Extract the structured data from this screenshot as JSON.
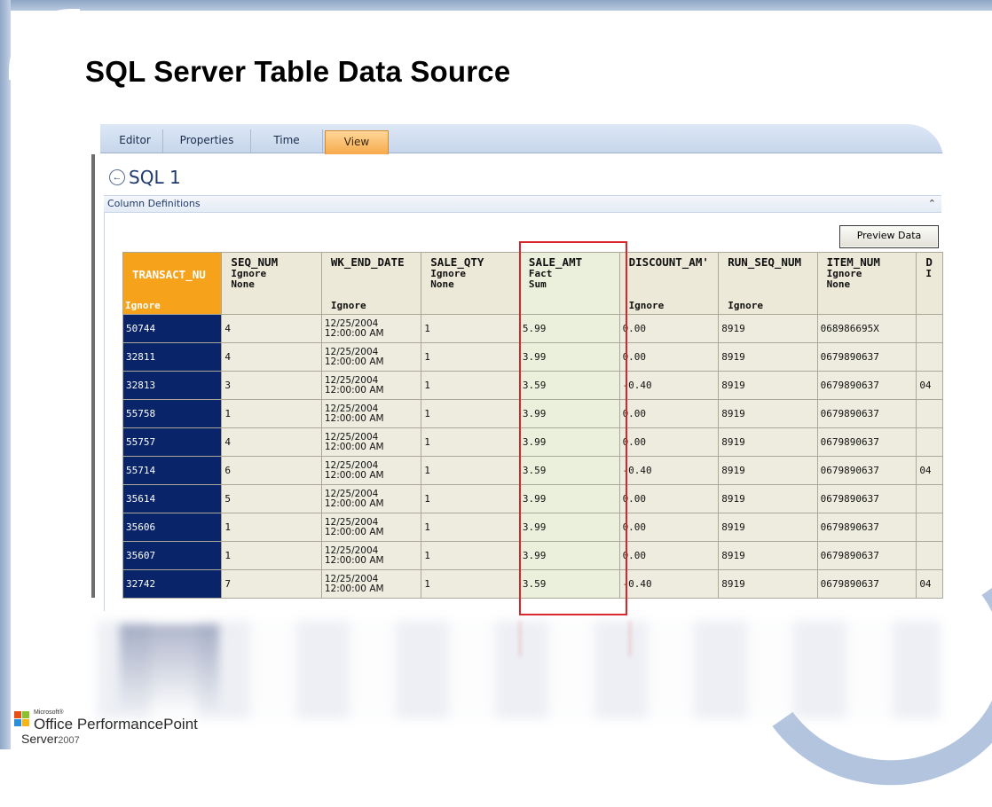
{
  "slide": {
    "title": "SQL Server Table Data Source"
  },
  "app": {
    "tabs": [
      {
        "label": "Editor",
        "active": false
      },
      {
        "label": "Properties",
        "active": false
      },
      {
        "label": "Time",
        "active": false
      },
      {
        "label": "View",
        "active": true
      }
    ],
    "pane_title": "SQL 1",
    "back_icon": "back-arrow-icon",
    "section_title": "Column Definitions",
    "collapse_icon": "double-chevron-up-icon",
    "preview_button": "Preview Data"
  },
  "grid": {
    "columns": [
      {
        "name": "TRANSACT_NU",
        "meta1": "",
        "meta2": "",
        "bottom": "Ignore"
      },
      {
        "name": "SEQ_NUM",
        "meta1": "Ignore",
        "meta2": "None",
        "bottom": ""
      },
      {
        "name": "WK_END_DATE",
        "meta1": "",
        "meta2": "",
        "bottom": "Ignore"
      },
      {
        "name": "SALE_QTY",
        "meta1": "Ignore",
        "meta2": "None",
        "bottom": ""
      },
      {
        "name": "SALE_AMT",
        "meta1": "Fact",
        "meta2": "Sum",
        "bottom": ""
      },
      {
        "name": "DISCOUNT_AM'",
        "meta1": "",
        "meta2": "",
        "bottom": "Ignore"
      },
      {
        "name": "RUN_SEQ_NUM",
        "meta1": "",
        "meta2": "",
        "bottom": "Ignore"
      },
      {
        "name": "ITEM_NUM",
        "meta1": "Ignore",
        "meta2": "None",
        "bottom": ""
      },
      {
        "name": "D",
        "meta1": "I",
        "meta2": "",
        "bottom": ""
      }
    ],
    "rows": [
      [
        "50744",
        "4",
        "12/25/2004|12:00:00 AM",
        "1",
        "5.99",
        "0.00",
        "8919",
        "068986695X",
        ""
      ],
      [
        "32811",
        "4",
        "12/25/2004|12:00:00 AM",
        "1",
        "3.99",
        "0.00",
        "8919",
        "0679890637",
        ""
      ],
      [
        "32813",
        "3",
        "12/25/2004|12:00:00 AM",
        "1",
        "3.59",
        "-0.40",
        "8919",
        "0679890637",
        "04"
      ],
      [
        "55758",
        "1",
        "12/25/2004|12:00:00 AM",
        "1",
        "3.99",
        "0.00",
        "8919",
        "0679890637",
        ""
      ],
      [
        "55757",
        "4",
        "12/25/2004|12:00:00 AM",
        "1",
        "3.99",
        "0.00",
        "8919",
        "0679890637",
        ""
      ],
      [
        "55714",
        "6",
        "12/25/2004|12:00:00 AM",
        "1",
        "3.59",
        "-0.40",
        "8919",
        "0679890637",
        "04"
      ],
      [
        "35614",
        "5",
        "12/25/2004|12:00:00 AM",
        "1",
        "3.99",
        "0.00",
        "8919",
        "0679890637",
        ""
      ],
      [
        "35606",
        "1",
        "12/25/2004|12:00:00 AM",
        "1",
        "3.99",
        "0.00",
        "8919",
        "0679890637",
        ""
      ],
      [
        "35607",
        "1",
        "12/25/2004|12:00:00 AM",
        "1",
        "3.99",
        "0.00",
        "8919",
        "0679890637",
        ""
      ],
      [
        "32742",
        "7",
        "12/25/2004|12:00:00 AM",
        "1",
        "3.59",
        "-0.40",
        "8919",
        "0679890637",
        "04"
      ]
    ]
  },
  "logo": {
    "microsoft": "Microsoft®",
    "product": "Office PerformancePoint",
    "server": "Server",
    "year": "2007"
  },
  "colors": {
    "key_header": "#f7a21b",
    "key_cell": "#0a246a",
    "highlight_border": "#d9262b",
    "active_tab": "#f6a94a"
  }
}
